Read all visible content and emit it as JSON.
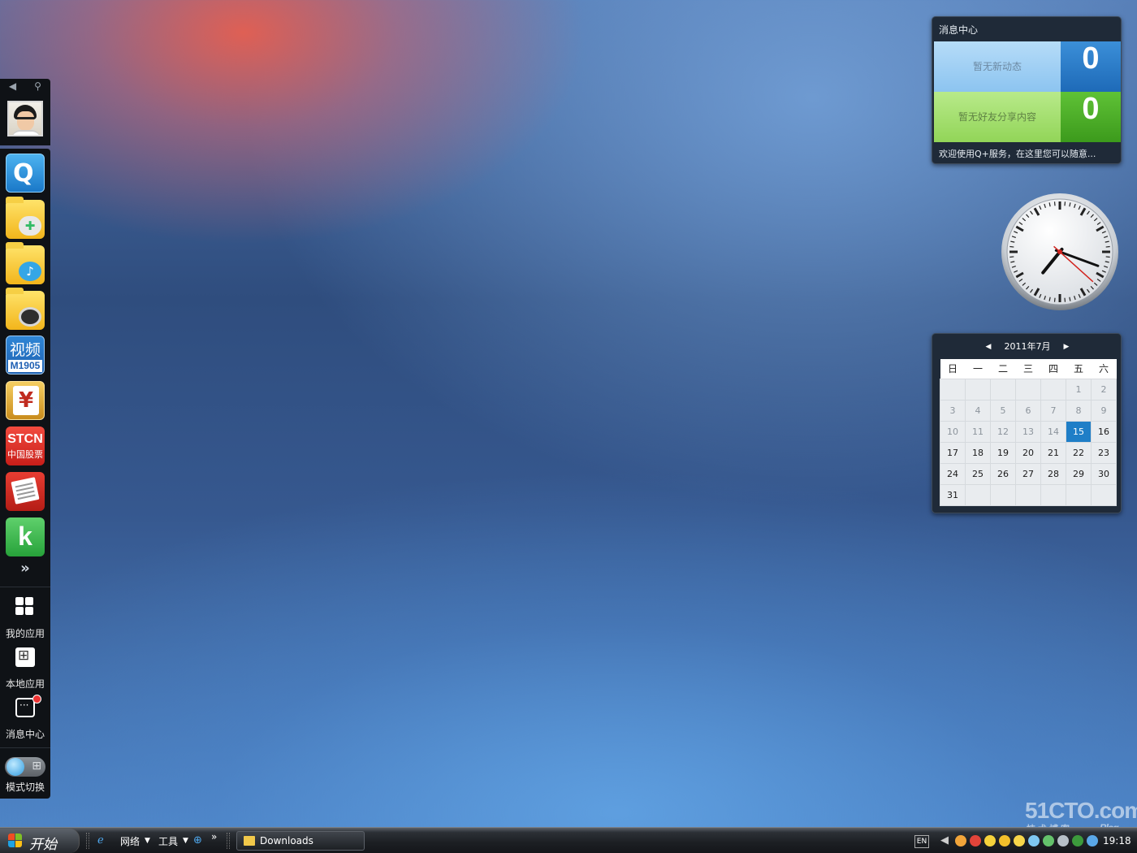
{
  "dock": {
    "top_controls": {
      "collapse_icon": "◀",
      "pin_icon": "📌"
    },
    "apps": [
      {
        "name": "qplus-icon",
        "glyph": "Q"
      },
      {
        "name": "games-folder-icon"
      },
      {
        "name": "music-folder-icon"
      },
      {
        "name": "camera-folder-icon"
      },
      {
        "name": "video-m1905",
        "line1": "视频",
        "line2": "M1905"
      },
      {
        "name": "finance-yen",
        "glyph": "¥"
      },
      {
        "name": "stcn-stock",
        "line1": "STCN",
        "line2": "中国股票"
      },
      {
        "name": "news-icon"
      },
      {
        "name": "k-app",
        "glyph": "k"
      }
    ],
    "more_icon": "»",
    "nav": {
      "my_apps": "我的应用",
      "local_apps": "本地应用",
      "message_center": "消息中心",
      "mode_switch": "模式切换"
    }
  },
  "message_widget": {
    "title": "消息中心",
    "rows": [
      {
        "text": "暂无新动态",
        "count": "0"
      },
      {
        "text": "暂无好友分享内容",
        "count": "0"
      }
    ],
    "footer": "欢迎使用Q+服务，在这里您可以随意..."
  },
  "clock": {
    "hour": 7,
    "minute": 18,
    "second": 22
  },
  "calendar": {
    "title": "2011年7月",
    "weekdays": [
      "日",
      "一",
      "二",
      "三",
      "四",
      "五",
      "六"
    ],
    "today": 15,
    "first_weekday_index": 5,
    "days_in_month": 31
  },
  "taskbar": {
    "start_label": "开始",
    "toolbar_network": "网络",
    "toolbar_tools": "工具",
    "chevron": "»",
    "task_button": "Downloads",
    "lang": "EN",
    "time": "19:18"
  },
  "watermark": {
    "main": "51CTO.com",
    "sub": "技术博客",
    "blog": "Blog"
  },
  "colors": {
    "accent_blue": "#1f7ec7",
    "msg_blue": "#3b8fd8",
    "msg_green": "#5fc236"
  }
}
